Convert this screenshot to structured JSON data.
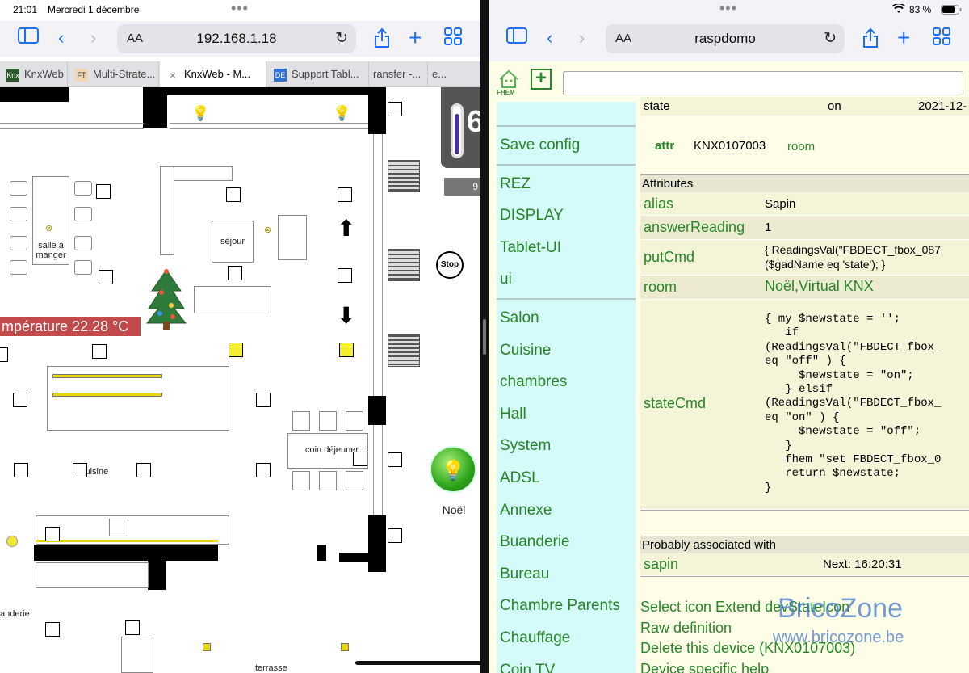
{
  "left": {
    "status": {
      "time": "21:01",
      "date": "Mercredi 1 décembre"
    },
    "url": "192.168.1.18",
    "aa": "AA",
    "tabs": [
      {
        "label": "KnxWeb",
        "fav": "Knx",
        "fav_color": "#2a5a2a"
      },
      {
        "label": "Multi-Strate...",
        "fav": "FT",
        "fav_color": "#f1d7b1"
      },
      {
        "label": "KnxWeb - M...",
        "fav": "×",
        "fav_color": "#aaaaaa",
        "active": true
      },
      {
        "label": "Support Tabl...",
        "fav": "DE",
        "fav_color": "#2f6fd0"
      },
      {
        "label": "ransfer -...",
        "fav": "",
        "fav_color": ""
      },
      {
        "label": "e...",
        "fav": "",
        "fav_color": ""
      }
    ],
    "plan": {
      "salle": "salle à\nmanger",
      "sejour": "séjour",
      "temperature": "mpérature 22.28 °C",
      "cuisine": "cuisine",
      "coin": "coin déjeuner",
      "noel": "Noël",
      "stop": "Stop",
      "buanderie": "anderie",
      "terrasse": "terrasse",
      "sensor_value": "6",
      "sensor_sub": "9"
    }
  },
  "right": {
    "status": {
      "battery": "83 %"
    },
    "url": "raspdomo",
    "aa": "AA",
    "fhem_logo": "FHEM",
    "sidebar": {
      "save": "Save config",
      "group1": [
        "REZ",
        "DISPLAY",
        "Tablet-UI",
        "ui"
      ],
      "group2": [
        "Salon",
        "Cuisine",
        "chambres",
        "Hall",
        "System",
        "ADSL",
        "Annexe",
        "Buanderie",
        "Bureau",
        "Chambre Parents",
        "Chauffage",
        "Coin TV"
      ]
    },
    "state_row": {
      "name": "state",
      "value": "on",
      "date": "2021-12-"
    },
    "attr_row": {
      "label": "attr",
      "device": "KNX0107003",
      "attr": "room"
    },
    "attributes_header": "Attributes",
    "attributes": [
      {
        "key": "alias",
        "value": "Sapin"
      },
      {
        "key": "answerReading",
        "value": "1"
      },
      {
        "key": "putCmd",
        "value": "{ ReadingsVal(\"FBDECT_fbox_087\n($gadName eq 'state'); }"
      },
      {
        "key": "room",
        "value": "Noël,Virtual KNX",
        "green": true
      },
      {
        "key": "stateCmd",
        "value": "{ my $newstate = '';\n   if\n(ReadingsVal(\"FBDECT_fbox_\neq \"off\" ) {\n     $newstate = \"on\";\n   } elsif\n(ReadingsVal(\"FBDECT_fbox_\neq \"on\" ) {\n     $newstate = \"off\";\n   }\n   fhem \"set FBDECT_fbox_0\n   return $newstate;\n}"
      }
    ],
    "assoc_header": "Probably associated with",
    "assoc": {
      "name": "sapin",
      "next": "Next: 16:20:31"
    },
    "links": [
      "Select icon  Extend devStateIcon",
      "Raw definition",
      "Delete this device (KNX0107003)",
      "Device specific help"
    ],
    "watermark": {
      "title": "BricoZone",
      "url": "www.bricozone.be"
    }
  }
}
